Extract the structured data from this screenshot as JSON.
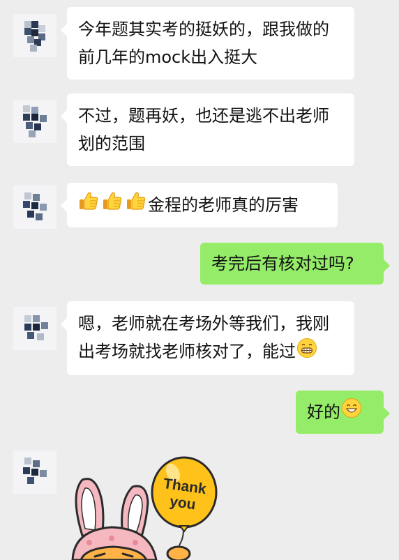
{
  "messages": [
    {
      "side": "left",
      "lines": [
        "今年题其实考的挺妖的，跟我做的",
        "前几年的mock出入挺大"
      ]
    },
    {
      "side": "left",
      "lines": [
        "不过，题再妖，也还是逃不出老师",
        "划的范围"
      ]
    },
    {
      "side": "left",
      "emoji_prefix": [
        "thumbs-up",
        "thumbs-up",
        "thumbs-up"
      ],
      "text": "金程的老师真的厉害"
    },
    {
      "side": "right",
      "text": "考完后有核对过吗?"
    },
    {
      "side": "left",
      "lines": [
        "嗯，老师就在考场外等我们，我刚",
        "出考场就找老师核对了，能过"
      ],
      "emoji_suffix": "grinning-face"
    },
    {
      "side": "right",
      "text": "好的",
      "emoji_suffix": "smiling-face"
    },
    {
      "side": "left",
      "sticker": {
        "balloon_text_1": "Thank",
        "balloon_text_2": "you",
        "character": "bunny-hat-cat"
      }
    }
  ],
  "colors": {
    "background": "#ededed",
    "incoming_bubble": "#ffffff",
    "outgoing_bubble": "#95ec69",
    "balloon": "#ffc21a"
  }
}
